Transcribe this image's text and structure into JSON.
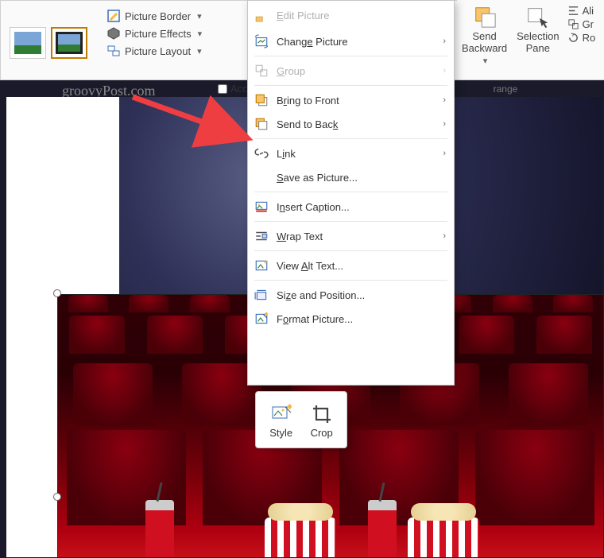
{
  "ribbon_mid": {
    "picture_border": "Picture Border",
    "picture_effects": "Picture Effects",
    "picture_layout": "Picture Layout"
  },
  "ribbon_right": {
    "send_backward": "Send\nBackward",
    "selection_pane": "Selection\nPane",
    "align": "Ali",
    "group": "Gr",
    "rotate": "Ro",
    "group_label": "range"
  },
  "accessibility": {
    "checkbox_label": "Acc"
  },
  "watermark": "groovyPost.com",
  "context_menu": {
    "edit_picture": "Edit Picture",
    "change_picture": "Change Picture",
    "group": "Group",
    "bring_to_front": "Bring to Front",
    "send_to_back": "Send to Back",
    "link": "Link",
    "save_as_picture": "Save as Picture...",
    "insert_caption": "Insert Caption...",
    "wrap_text": "Wrap Text",
    "view_alt_text": "View Alt Text...",
    "size_and_position": "Size and Position...",
    "format_picture": "Format Picture..."
  },
  "mini_toolbar": {
    "style": "Style",
    "crop": "Crop"
  }
}
